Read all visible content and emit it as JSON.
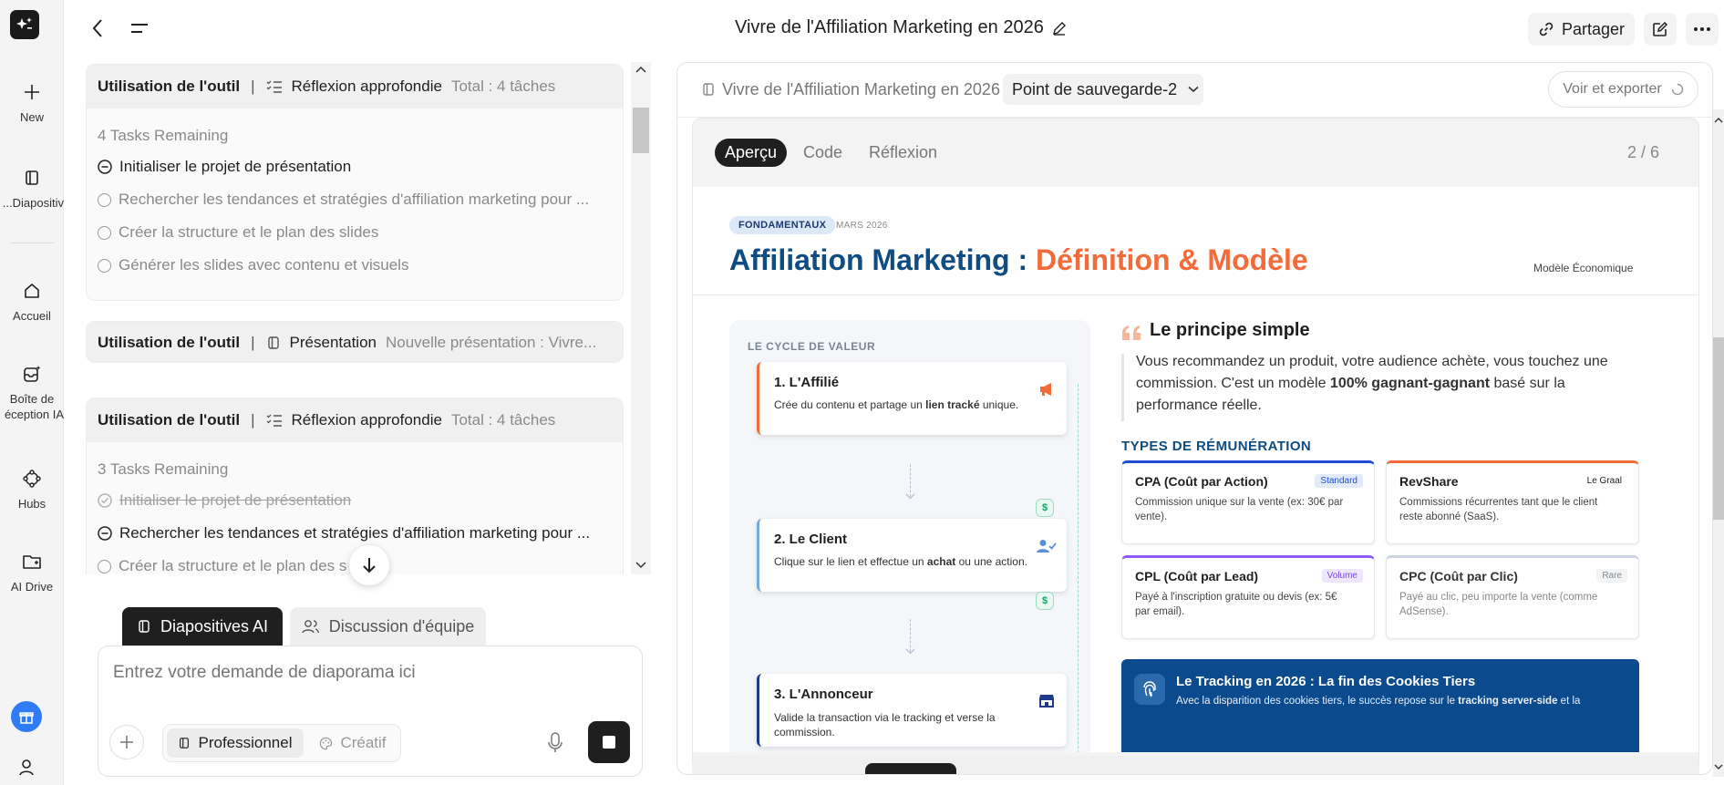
{
  "nav": {
    "new_label": "New",
    "slides_label": "Diapositiv...",
    "home_label": "Accueil",
    "inbox_label_1": "Boîte de",
    "inbox_label_2": "éception IA",
    "hubs_label": "Hubs",
    "drive_label": "AI Drive"
  },
  "header": {
    "title": "Vivre de l'Affiliation Marketing en 2026",
    "share_label": "Partager"
  },
  "chat": {
    "cards": [
      {
        "tool": "Utilisation de l'outil",
        "type": "Réflexion approfondie",
        "meta": "Total : 4 tâches",
        "remaining": "4 Tasks Remaining",
        "tasks": [
          "Initialiser le projet de présentation",
          "Rechercher les tendances et stratégies d'affiliation marketing pour ...",
          "Créer la structure et le plan des slides",
          "Générer les slides avec contenu et visuels"
        ]
      },
      {
        "tool": "Utilisation de l'outil",
        "type": "Présentation",
        "meta": "Nouvelle présentation : Vivre..."
      },
      {
        "tool": "Utilisation de l'outil",
        "type": "Réflexion approfondie",
        "meta": "Total : 4 tâches",
        "remaining": "3 Tasks Remaining",
        "tasks": [
          "Initialiser le projet de présentation",
          "Rechercher les tendances et stratégies d'affiliation marketing pour ...",
          "Créer la structure et le plan des s"
        ]
      }
    ],
    "mode_tabs": [
      "Diapositives AI",
      "Discussion d'équipe"
    ],
    "input_placeholder": "Entrez votre demande de diaporama ici",
    "style_options": [
      "Professionnel",
      "Créatif"
    ]
  },
  "preview": {
    "doc_title": "Vivre de l'Affiliation Marketing en 2026",
    "checkpoint": "Point de sauvegarde-2",
    "export_label": "Voir et exporter",
    "tabs": [
      "Aperçu",
      "Code",
      "Réflexion"
    ],
    "page_indicator": "2 / 6"
  },
  "slide": {
    "badge": "FONDAMENTAUX",
    "date": "MARS 2026",
    "title_part1": "Affiliation Marketing : ",
    "title_part2": "Définition & Modèle",
    "subtitle_right": "Modèle Économique",
    "cycle_label": "LE CYCLE DE VALEUR",
    "steps": [
      {
        "title": "1. L'Affilié",
        "desc_pre": "Crée du contenu et partage un ",
        "desc_bold": "lien tracké",
        "desc_post": " unique."
      },
      {
        "title": "2. Le Client",
        "desc_pre": "Clique sur le lien et effectue un ",
        "desc_bold": "achat",
        "desc_post": " ou une action."
      },
      {
        "title": "3. L'Annonceur",
        "desc_pre": "Valide la transaction via le tracking et verse la",
        "desc_bold": "",
        "desc_post": " commission."
      }
    ],
    "principle_title": "Le principe simple",
    "principle_text_1": "Vous recommandez un produit, votre audience achète, vous touchez une",
    "principle_text_2a": "commission. C'est un modèle ",
    "principle_text_2b": "100% gagnant-gagnant",
    "principle_text_2c": " basé sur la",
    "principle_text_3": "performance réelle.",
    "types_label": "TYPES DE RÉMUNÉRATION",
    "types": [
      {
        "name": "CPA (Coût par Action)",
        "tag": "Standard",
        "desc1": "Commission unique sur la vente (ex: 30€ par",
        "desc2": "vente).",
        "color": "#1d4ed8"
      },
      {
        "name": "RevShare",
        "tag": "Le Graal",
        "desc1": "Commissions récurrentes tant que le client",
        "desc2": "reste abonné (SaaS).",
        "color": "#f26b3a"
      },
      {
        "name": "CPL (Coût par Lead)",
        "tag": "Volume",
        "desc1": "Payé à l'inscription gratuite ou devis (ex: 5€",
        "desc2": "par email).",
        "color": "#8b5cf6"
      },
      {
        "name": "CPC (Coût par Clic)",
        "tag": "Rare",
        "desc1": "Payé au clic, peu importe la vente (comme",
        "desc2": "AdSense).",
        "color": "#cbd5e1"
      }
    ],
    "tracking_title": "Le Tracking en 2026 : La fin des Cookies Tiers",
    "tracking_text_pre": "Avec la disparition des cookies tiers, le succès repose sur le ",
    "tracking_text_bold": "tracking server-side",
    "tracking_text_post": " et la"
  },
  "colors": {
    "navy": "#0f4c81",
    "orange": "#f26b3a",
    "dark_button": "#1f1f1f",
    "gift_blue": "#2f7cf6"
  }
}
